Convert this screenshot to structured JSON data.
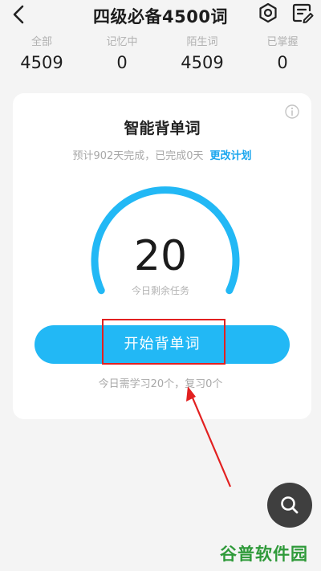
{
  "header": {
    "title": "四级必备4500词",
    "back_icon": "back-arrow-icon",
    "settings_icon": "settings-icon",
    "list_icon": "word-list-icon"
  },
  "stats": [
    {
      "label": "全部",
      "value": "4509"
    },
    {
      "label": "记忆中",
      "value": "0"
    },
    {
      "label": "陌生词",
      "value": "4509"
    },
    {
      "label": "已掌握",
      "value": "0"
    }
  ],
  "card": {
    "title": "智能背单词",
    "plan_text": "预计902天完成，已完成0天",
    "plan_link": "更改计划",
    "info_icon": "info-icon",
    "remaining_count": "20",
    "remaining_caption": "今日剩余任务",
    "start_button_label": "开始背单词",
    "today_summary": "今日需学习20个，复习0个"
  },
  "search_fab_icon": "search-icon",
  "watermark": "谷普软件园",
  "colors": {
    "accent": "#22b8f5",
    "link": "#1aa6ee",
    "highlight": "#e22020",
    "background": "#f4f4f4"
  }
}
